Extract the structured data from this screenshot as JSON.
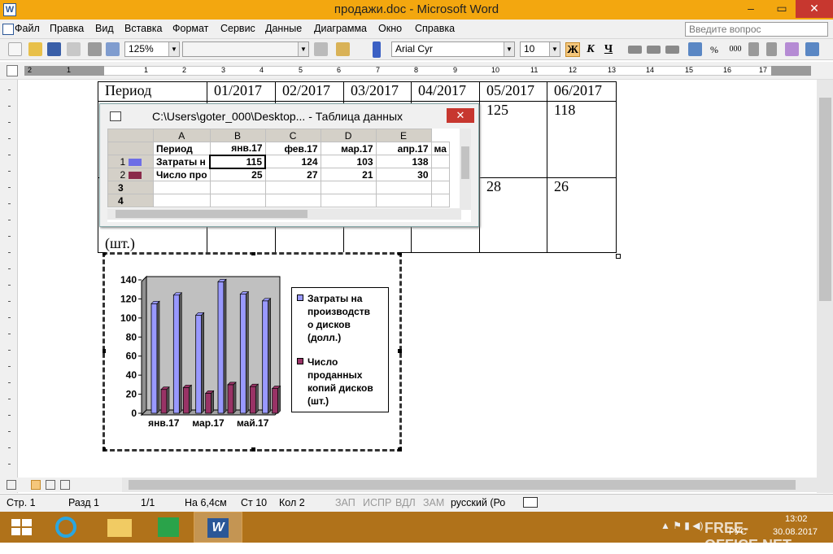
{
  "window": {
    "title": "продажи.doc - Microsoft Word",
    "app_icon": "W",
    "min": "–",
    "max": "▭",
    "close": "✕"
  },
  "menu": [
    "Файл",
    "Правка",
    "Вид",
    "Вставка",
    "Формат",
    "Сервис",
    "Данные",
    "Диаграмма",
    "Окно",
    "Справка"
  ],
  "help_placeholder": "Введите вопрос",
  "toolbar": {
    "zoom": "125%",
    "font": "Arial Cyr",
    "size": "10",
    "bold": "Ж",
    "italic": "К",
    "underline": "Ч"
  },
  "ruler_marks": [
    "2",
    "1",
    "1",
    "2",
    "3",
    "4",
    "5",
    "6",
    "7",
    "8",
    "9",
    "10",
    "11",
    "12",
    "13",
    "14",
    "15",
    "16",
    "17"
  ],
  "doc_table": {
    "header": [
      "Период",
      "01/2017",
      "02/2017",
      "03/2017",
      "04/2017",
      "05/2017",
      "06/2017"
    ],
    "row1": [
      "125",
      "118"
    ],
    "row2": [
      "28",
      "26"
    ],
    "row2_label_fragment": "(шт.)"
  },
  "datasheet": {
    "title": "C:\\Users\\goter_000\\Desktop... - Таблица данных",
    "cols": [
      "A",
      "B",
      "C",
      "D",
      "E"
    ],
    "rows": [
      {
        "num": "",
        "label": "Период",
        "vals": [
          "янв.17",
          "фев.17",
          "мар.17",
          "апр.17",
          "ма"
        ]
      },
      {
        "num": "1",
        "label": "Затраты н",
        "vals": [
          "115",
          "124",
          "103",
          "138",
          ""
        ]
      },
      {
        "num": "2",
        "label": "Число про",
        "vals": [
          "25",
          "27",
          "21",
          "30",
          ""
        ]
      },
      {
        "num": "3",
        "label": "",
        "vals": [
          "",
          "",
          "",
          "",
          ""
        ]
      },
      {
        "num": "4",
        "label": "",
        "vals": [
          "",
          "",
          "",
          "",
          ""
        ]
      }
    ]
  },
  "chart_data": {
    "type": "bar",
    "categories": [
      "янв.17",
      "фев.17",
      "мар.17",
      "апр.17",
      "май.17",
      "июн.17"
    ],
    "x_tick_labels": [
      "янв.17",
      "мар.17",
      "май.17"
    ],
    "series": [
      {
        "name": "Затраты на производств о дисков (долл.)",
        "values": [
          115,
          124,
          103,
          138,
          125,
          118
        ],
        "color": "#9999ff"
      },
      {
        "name": "Число проданных копий дисков (шт.)",
        "values": [
          25,
          27,
          21,
          30,
          28,
          26
        ],
        "color": "#993366"
      }
    ],
    "ylim": [
      0,
      140
    ],
    "yticks": [
      "0",
      "20",
      "40",
      "60",
      "80",
      "100",
      "120",
      "140"
    ],
    "plot_bg": "#c0c0c0",
    "legend_lines": [
      [
        "Затраты на",
        "производств",
        "о дисков",
        "(долл.)"
      ],
      [
        "Число",
        "проданных",
        "копий дисков",
        "(шт.)"
      ]
    ],
    "legend_position": "right",
    "grid": true
  },
  "status": {
    "page": "Стр. 1",
    "section": "Разд 1",
    "pages": "1/1",
    "at": "На 6,4см",
    "line": "Ст 10",
    "col": "Кол 2",
    "rec": "ЗАП",
    "trk": "ИСПР",
    "ext": "ВДЛ",
    "ovr": "ЗАМ",
    "lang": "русский (Ро"
  },
  "taskbar": {
    "lang": "РУС",
    "time": "13:02",
    "date": "30.08.2017",
    "watermark": "FREE-OFFICE.NET"
  }
}
